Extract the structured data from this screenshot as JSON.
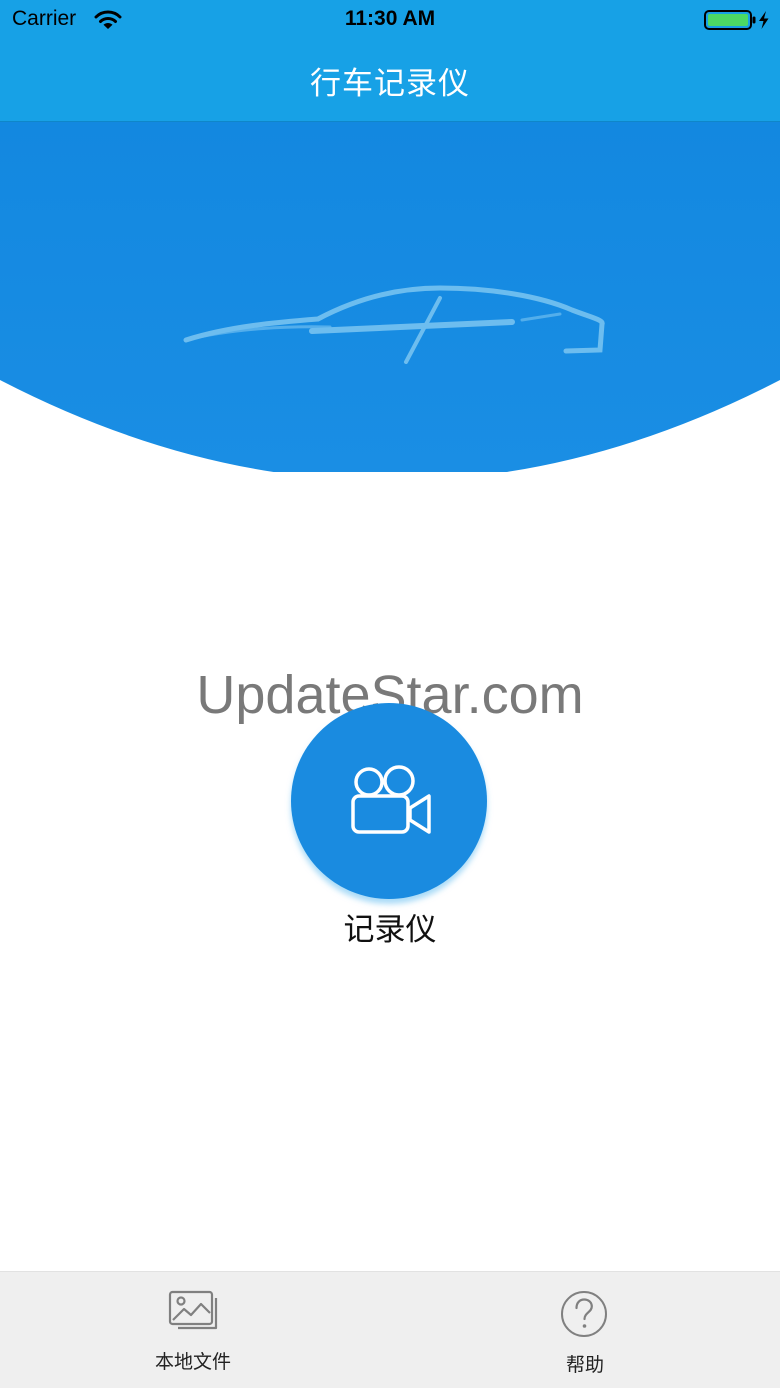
{
  "status_bar": {
    "carrier": "Carrier",
    "time": "11:30 AM",
    "wifi_icon": "wifi-icon",
    "battery_icon": "battery-charging-icon"
  },
  "nav": {
    "title": "行车记录仪"
  },
  "hero": {
    "illustration_icon": "car-silhouette-icon"
  },
  "watermark": {
    "text": "UpdateStar.com"
  },
  "recorder": {
    "icon": "video-camera-icon",
    "label": "记录仪"
  },
  "tabs": [
    {
      "label": "本地文件",
      "icon": "image-gallery-icon"
    },
    {
      "label": "帮助",
      "icon": "help-circle-icon"
    }
  ],
  "colors": {
    "primary_blue": "#17a1e6",
    "hero_blue": "#138ae0",
    "button_blue": "#1a8be0",
    "battery_green": "#4cd964",
    "tab_bar_bg": "#efefef"
  }
}
